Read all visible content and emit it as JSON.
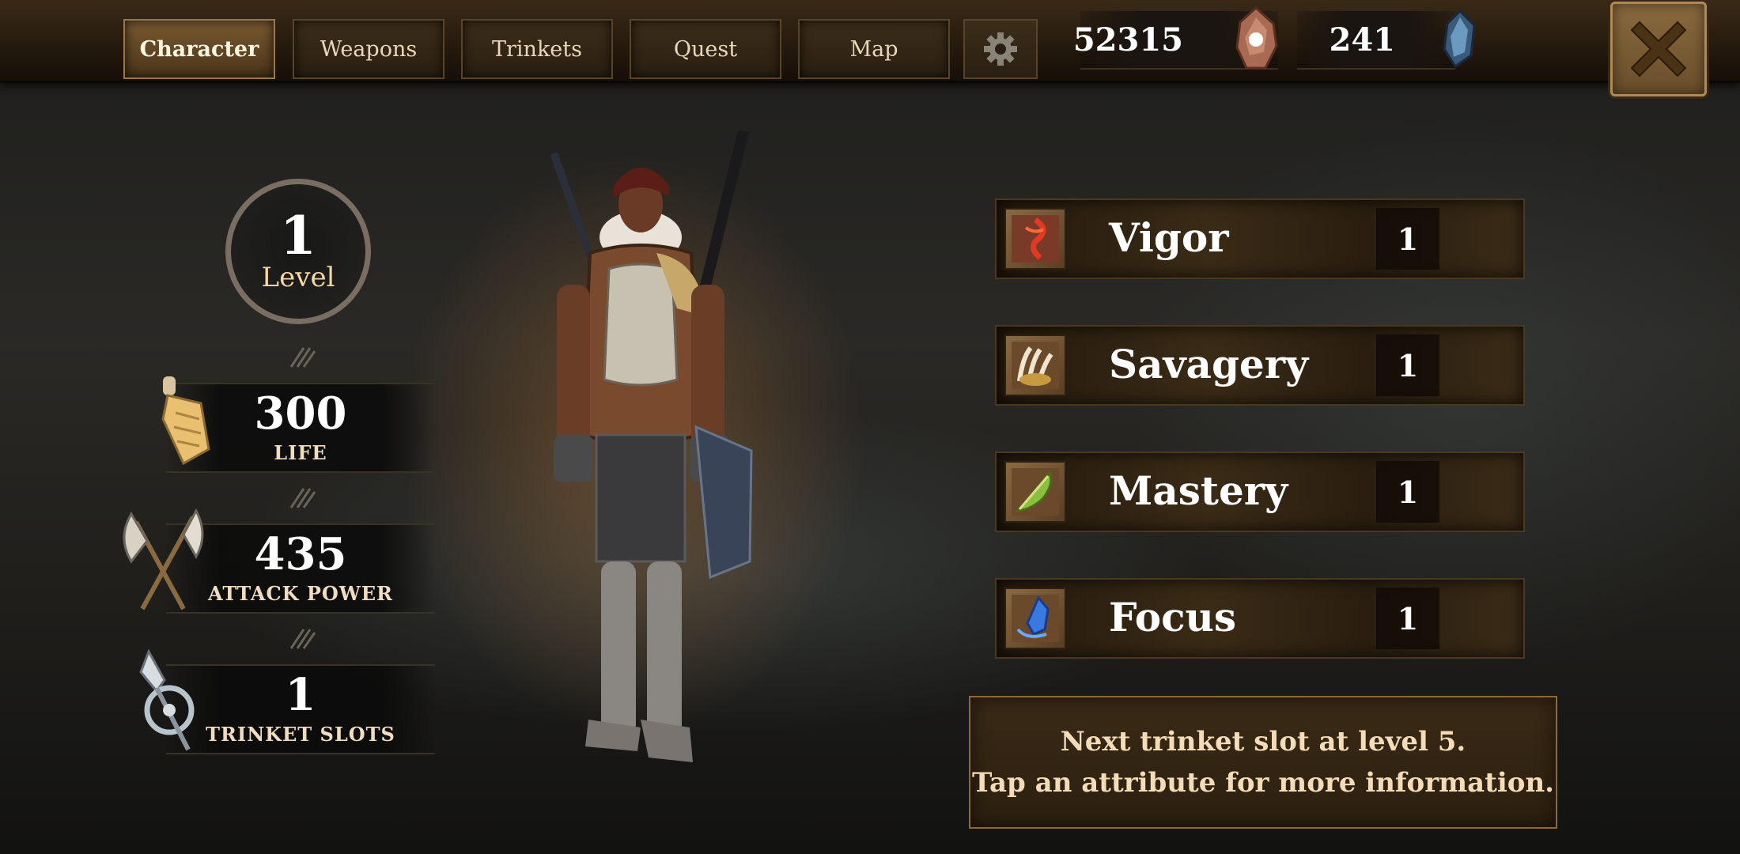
{
  "tabs": [
    {
      "label": "Character",
      "active": true
    },
    {
      "label": "Weapons",
      "active": false
    },
    {
      "label": "Trinkets",
      "active": false
    },
    {
      "label": "Quest",
      "active": false
    },
    {
      "label": "Map",
      "active": false
    }
  ],
  "settings_icon": "gear-icon",
  "currency": {
    "gold": {
      "value": "52315",
      "icon": "ore-crystal-icon"
    },
    "gems": {
      "value": "241",
      "icon": "blue-gem-icon"
    }
  },
  "close_icon": "close-icon",
  "level": {
    "value": "1",
    "label": "Level"
  },
  "stats": [
    {
      "value": "300",
      "label": "LIFE",
      "icon": "life-scroll-icon"
    },
    {
      "value": "435",
      "label": "ATTACK POWER",
      "icon": "crossed-axes-icon"
    },
    {
      "value": "1",
      "label": "TRINKET SLOTS",
      "icon": "trinket-amulet-icon"
    }
  ],
  "attributes": [
    {
      "name": "Vigor",
      "value": "1",
      "icon": "vigor-icon"
    },
    {
      "name": "Savagery",
      "value": "1",
      "icon": "claw-icon"
    },
    {
      "name": "Mastery",
      "value": "1",
      "icon": "feather-icon"
    },
    {
      "name": "Focus",
      "value": "1",
      "icon": "focus-icon"
    }
  ],
  "info": {
    "line1": "Next trinket slot at level 5.",
    "line2": "Tap an attribute for more information."
  },
  "colors": {
    "accent_gold": "#9a7846",
    "panel_dark": "#24190d",
    "text_cream": "#f5dcb8"
  }
}
